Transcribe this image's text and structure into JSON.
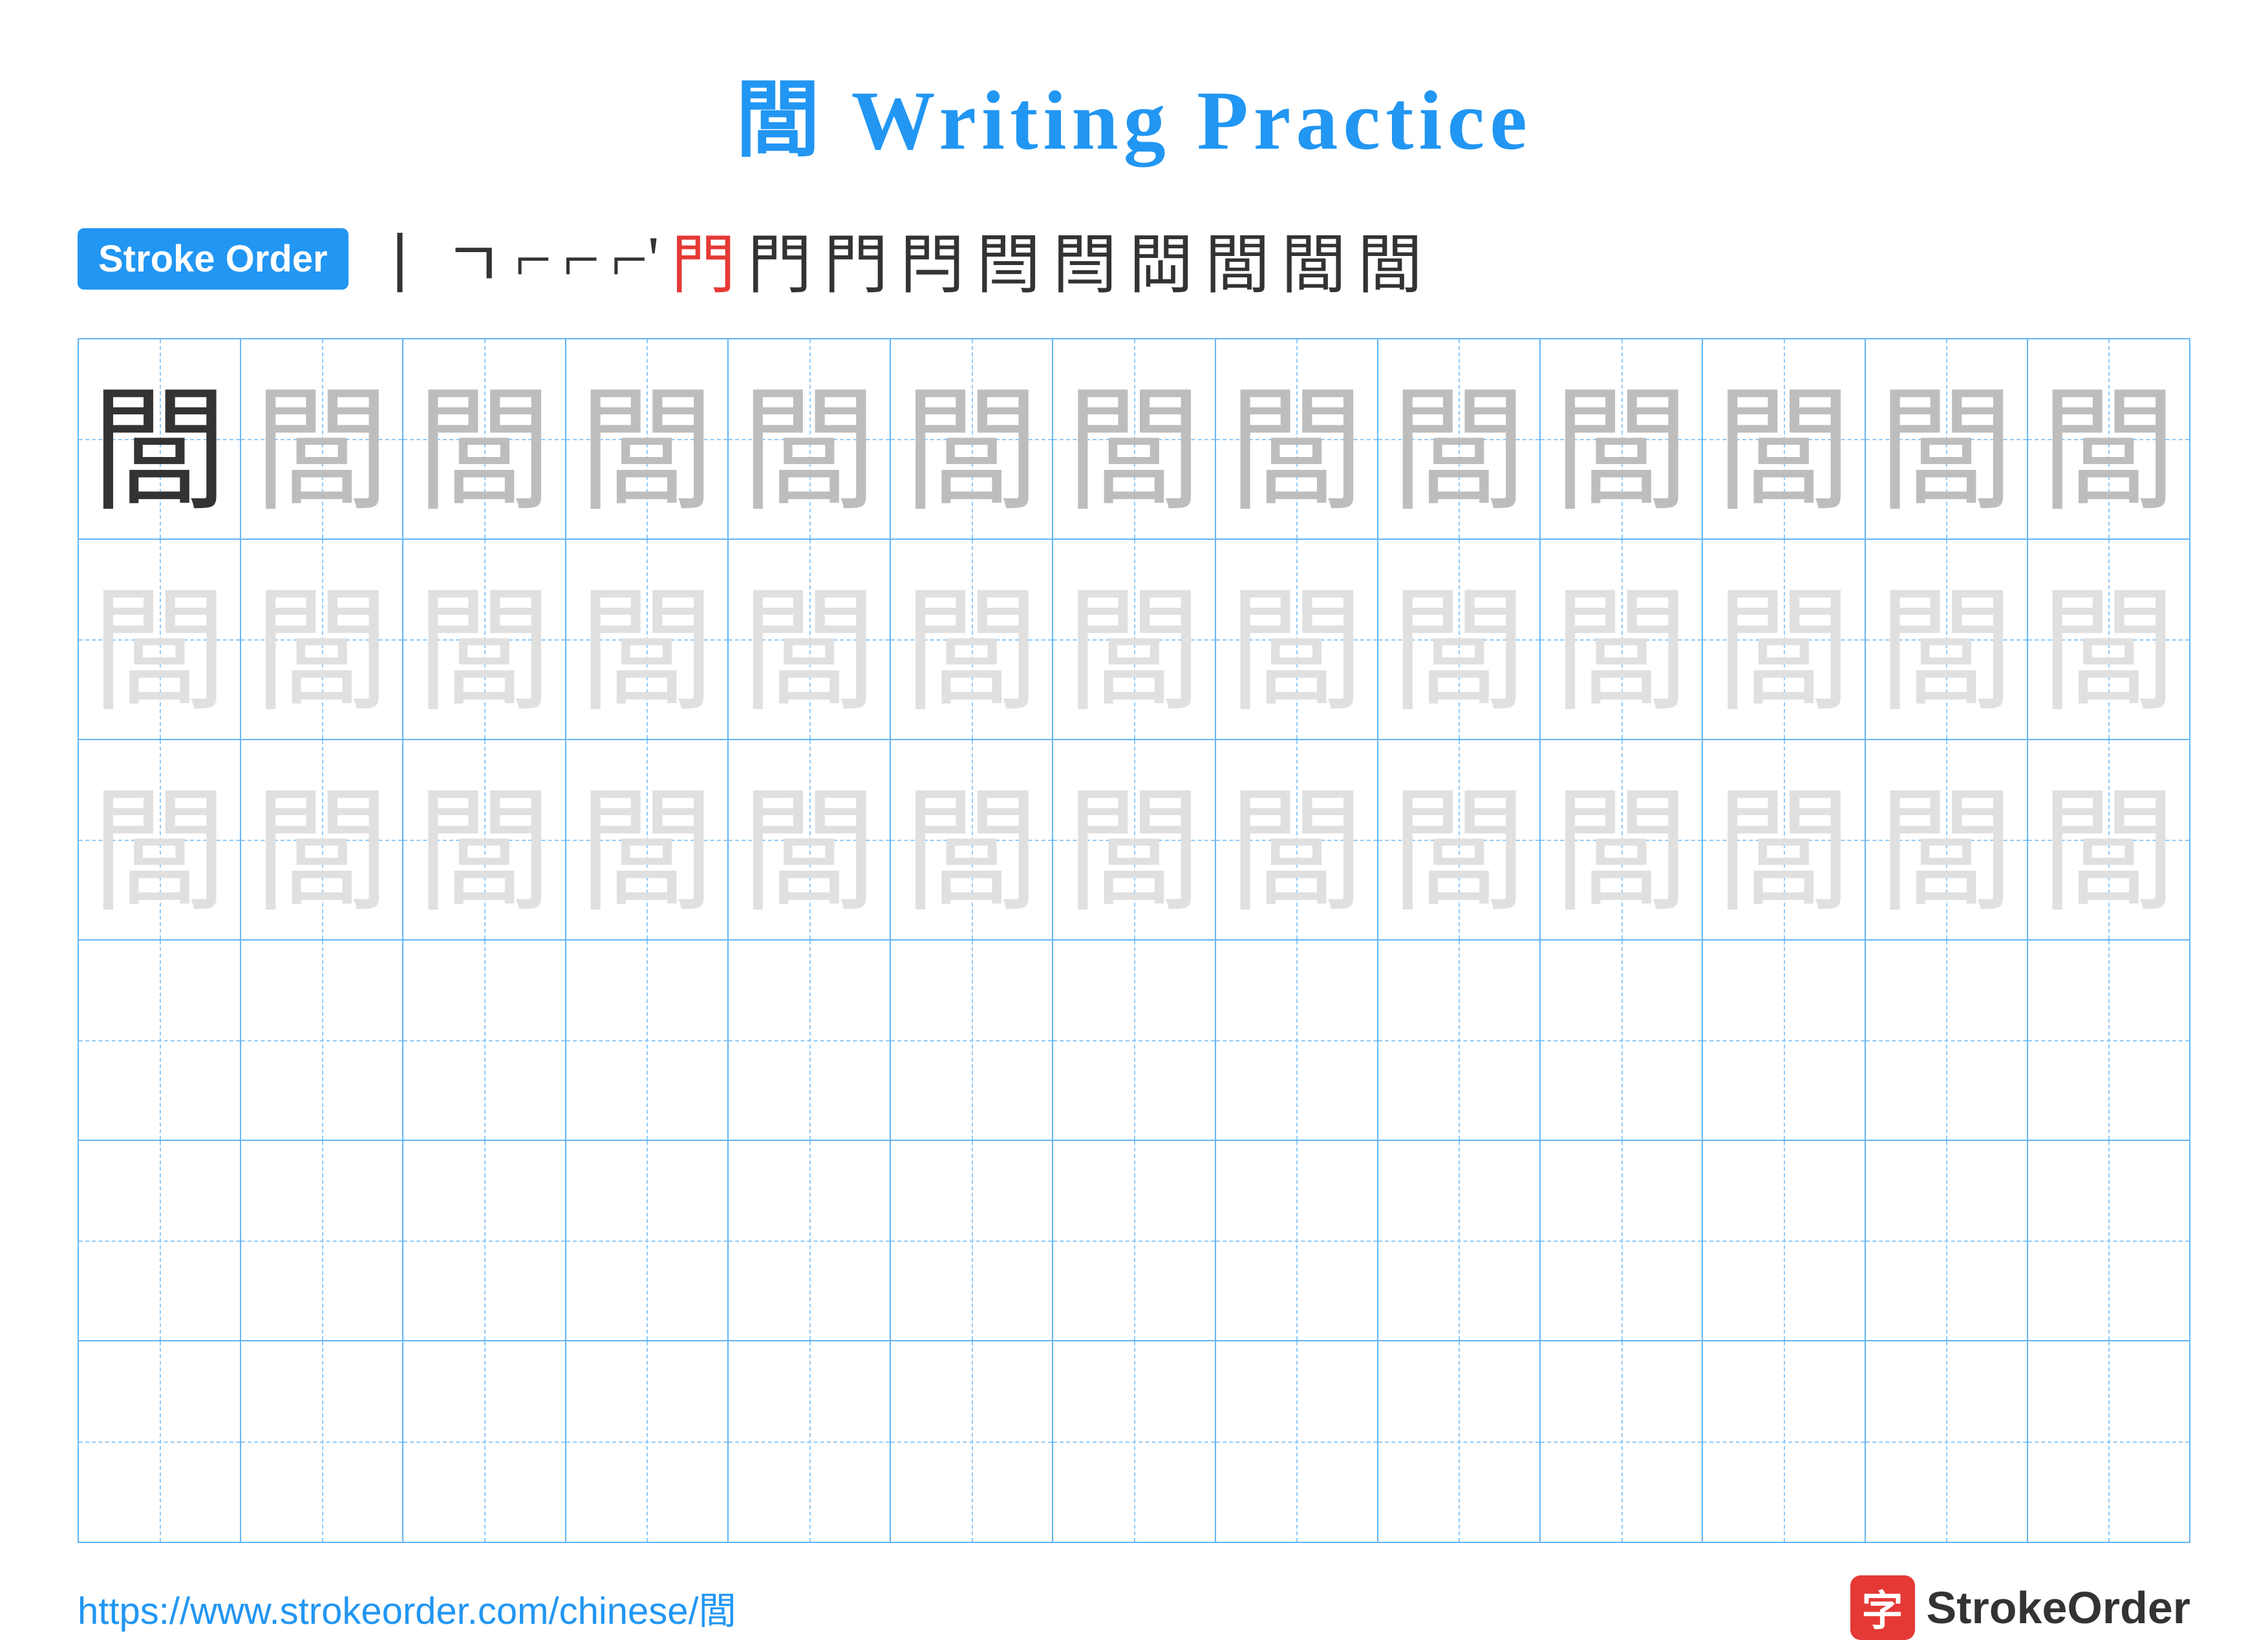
{
  "title": {
    "char": "閭",
    "text": "Writing Practice"
  },
  "stroke_order": {
    "badge_label": "Stroke Order",
    "strokes": [
      "丨",
      "⌐",
      "ㄈ",
      "ㄈ",
      "ㄈ'",
      "門",
      "門",
      "門",
      "閂",
      "閆",
      "閆",
      "閊",
      "閭",
      "閭",
      "閭"
    ]
  },
  "grid": {
    "rows": 6,
    "cols": 13,
    "chars": {
      "dark": "閭",
      "medium": "閭",
      "light": "閭"
    }
  },
  "footer": {
    "url": "https://www.strokeorder.com/chinese/閭",
    "logo_char": "字",
    "logo_text": "StrokeOrder"
  }
}
